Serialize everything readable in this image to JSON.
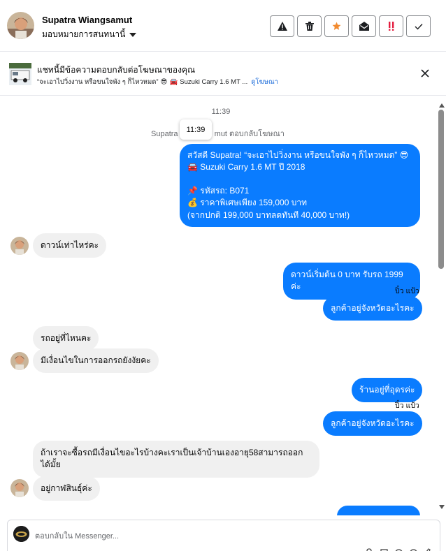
{
  "header": {
    "name": "Supatra Wiangsamut",
    "assign_label": "มอบหมายการสนทนานี้"
  },
  "actions": [
    {
      "name": "spam-button",
      "icon": "warning-icon"
    },
    {
      "name": "delete-button",
      "icon": "trash-icon"
    },
    {
      "name": "follow-up-button",
      "icon": "star-icon"
    },
    {
      "name": "mark-unread-button",
      "icon": "envelope-open-icon"
    },
    {
      "name": "priority-button",
      "icon": "exclamation-icon"
    },
    {
      "name": "done-button",
      "icon": "check-icon"
    }
  ],
  "ad_notice": {
    "title": "แชทนี้มีข้อความตอบกลับต่อโฆษณาของคุณ",
    "quote": "“จะเอาไปวิ่งงาน หรือขนใจพัง ๆ ก็ไหวหมด”",
    "emoji1": "😎",
    "emoji2": "🚘",
    "car_text": "Suzuki Carry 1.6 MT ...",
    "link": "ดูโฆษณา"
  },
  "chat": {
    "timestamp_top": "11:39",
    "tooltip_time": "11:39",
    "replied_notice_left": "Supatra",
    "replied_notice_right": "mut ตอบกลับโฆษณา",
    "ad_message": {
      "line1": "สวัสดี Supatra! “จะเอาไปวิ่งงาน หรือขนใจพัง ๆ ก็ไหวหมด” 😎",
      "line2": "🚘 Suzuki Carry 1.6 MT ปี 2018",
      "line3": "📌 รหัสรถ: B071",
      "line4": "💰 ราคาพิเศษเพียง 159,000 บาท",
      "line5": "(จากปกติ 199,000 บาทลดทันที 40,000 บาท!)"
    },
    "messages": [
      {
        "side": "in",
        "text": "ดาวน์เท่าไหร่คะ"
      },
      {
        "side": "out",
        "text": "ดาวน์เริ่มต้น 0 บาท รับรถ 1999 ค่ะ"
      },
      {
        "side": "seen",
        "text": "ปิ๋ว แป้ว"
      },
      {
        "side": "out",
        "text": "ลูกค้าอยู่จังหวัดอะไรคะ"
      },
      {
        "side": "in",
        "text": "รถอยู่ที่ไหนคะ"
      },
      {
        "side": "in",
        "text": "มีเงื่อนไขในการออกรถยังงัยคะ"
      },
      {
        "side": "out",
        "text": "ร้านอยู่ที่อุดรค่ะ"
      },
      {
        "side": "seen",
        "text": "ปิ๋ว แป้ว"
      },
      {
        "side": "out",
        "text": "ลูกค้าอยู่จังหวัดอะไรคะ"
      },
      {
        "side": "in",
        "text": "ถ้าเราจะซื้อรถมีเงื่อนไขอะไรบ้างคะเราเป็นเจ้าบ้านเองอายุ58สามารถออกได้มั้ย"
      },
      {
        "side": "in",
        "text": "อยู่กาฬสินธุ์ค่ะ"
      }
    ]
  },
  "composer": {
    "placeholder": "ตอบกลับใน Messenger..."
  },
  "colors": {
    "outgoing_bubble": "#0a7cff",
    "incoming_bubble": "#f0f0f0",
    "link": "#216fdb",
    "star": "#f28b30",
    "priority": "#e41e3f"
  }
}
